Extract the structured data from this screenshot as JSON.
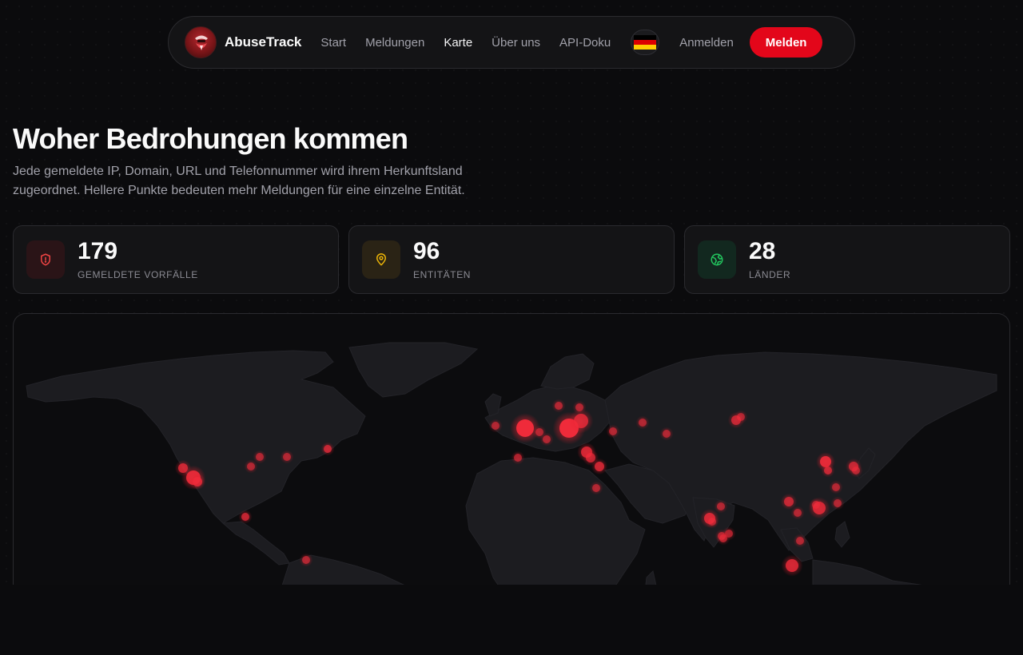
{
  "nav": {
    "brand": "AbuseTrack",
    "links": [
      {
        "label": "Start",
        "active": false
      },
      {
        "label": "Meldungen",
        "active": false
      },
      {
        "label": "Karte",
        "active": true
      },
      {
        "label": "Über uns",
        "active": false
      },
      {
        "label": "API-Doku",
        "active": false
      }
    ],
    "language_icon": "flag-germany-icon",
    "signin_label": "Anmelden",
    "report_label": "Melden"
  },
  "header": {
    "title": "Woher Bedrohungen kommen",
    "subtitle": "Jede gemeldete IP, Domain, URL und Telefonnummer wird ihrem Herkunftsland zugeordnet. Hellere Punkte bedeuten mehr Meldungen für eine einzelne Entität."
  },
  "stats": [
    {
      "value": "179",
      "label": "Gemeldete Vorfälle",
      "icon": "shield-alert-icon",
      "color": "#ef4444"
    },
    {
      "value": "96",
      "label": "Entitäten",
      "icon": "map-pin-icon",
      "color": "#eab308"
    },
    {
      "value": "28",
      "label": "Länder",
      "icon": "globe-icon",
      "color": "#22c55e"
    }
  ],
  "colors": {
    "accent": "#e3061a",
    "background": "#0b0b0d",
    "card": "#141416",
    "land": "#1c1c20",
    "dot": "#ef2b3a"
  }
}
